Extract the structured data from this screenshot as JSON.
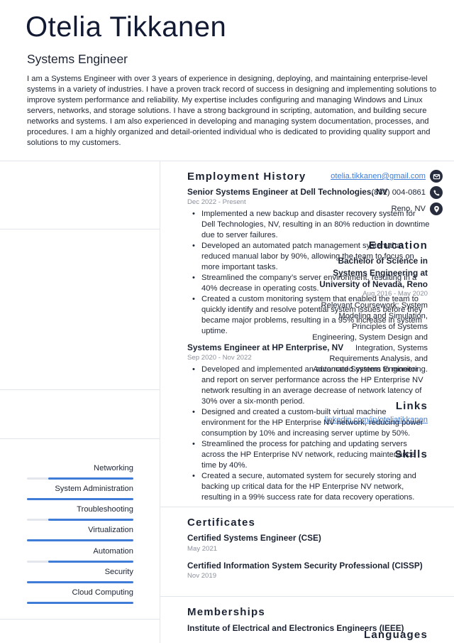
{
  "header": {
    "name": "Otelia Tikkanen",
    "title": "Systems Engineer",
    "summary": "I am a Systems Engineer with over 3 years of experience in designing, deploying, and maintaining enterprise-level systems in a variety of industries. I have a proven track record of success in designing and implementing solutions to improve system performance and reliability. My expertise includes configuring and managing Windows and Linux servers, networks, and storage solutions. I have a strong background in scripting, automation, and building secure networks and systems. I am also experienced in developing and managing system documentation, processes, and procedures. I am a highly organized and detail-oriented individual who is dedicated to providing quality support and solutions to my customers."
  },
  "contact": {
    "email": "otelia.tikkanen@gmail.com",
    "phone": "(831) 004-0861",
    "location": "Reno, NV",
    "icons": [
      "envelope-icon",
      "phone-icon",
      "map-pin-icon"
    ]
  },
  "education": {
    "heading": "Education",
    "degree": "Bachelor of Science in Systems Engineering at University of Nevada, Reno",
    "dates": "Aug 2016 - May 2020",
    "description": "Relevant Coursework: System Modeling and Simulation, Principles of Systems Engineering, System Design and Integration, Systems Requirements Analysis, and Advanced Systems Engineering."
  },
  "links": {
    "heading": "Links",
    "items": [
      "linkedin.com/in/oteliatikkanen"
    ]
  },
  "skills": {
    "heading": "Skills",
    "items": [
      {
        "name": "Networking",
        "level": 0.8
      },
      {
        "name": "System Administration",
        "level": 1.0
      },
      {
        "name": "Troubleshooting",
        "level": 0.8
      },
      {
        "name": "Virtualization",
        "level": 1.0
      },
      {
        "name": "Automation",
        "level": 0.8
      },
      {
        "name": "Security",
        "level": 1.0
      },
      {
        "name": "Cloud Computing",
        "level": 1.0
      }
    ]
  },
  "languages": {
    "heading": "Languages"
  },
  "employment": {
    "heading": "Employment History",
    "jobs": [
      {
        "title": "Senior Systems Engineer at Dell Technologies, NV",
        "dates": "Dec 2022 - Present",
        "bullets": [
          "Implemented a new backup and disaster recovery system for Dell Technologies, NV, resulting in an 80% reduction in downtime due to server failures.",
          "Developed an automated patch management system that reduced manual labor by 90%, allowing the team to focus on more important tasks.",
          "Streamlined the company’s server environment, resulting in a 40% decrease in operating costs.",
          "Created a custom monitoring system that enabled the team to quickly identify and resolve potential system issues before they became major problems, resulting in a 95% increase in system uptime."
        ]
      },
      {
        "title": "Systems Engineer at HP Enterprise, NV",
        "dates": "Sep 2020 - Nov 2022",
        "bullets": [
          "Developed and implemented an automated system to monitor and report on server performance across the HP Enterprise NV network resulting in an average decrease of network latency of 30% over a six-month period.",
          "Designed and created a custom-built virtual machine environment for the HP Enterprise NV network, reducing power consumption by 10% and increasing server uptime by 50%.",
          "Streamlined the process for patching and updating servers across the HP Enterprise NV network, reducing maintenance time by 40%.",
          "Created a secure, automated system for securely storing and backing up critical data for the HP Enterprise NV network, resulting in a 99% success rate for data recovery operations."
        ]
      }
    ]
  },
  "certificates": {
    "heading": "Certificates",
    "items": [
      {
        "name": "Certified Systems Engineer (CSE)",
        "date": "May 2021"
      },
      {
        "name": "Certified Information System Security Professional (CISSP)",
        "date": "Nov 2019"
      }
    ]
  },
  "memberships": {
    "heading": "Memberships",
    "items": [
      "Institute of Electrical and Electronics Engineers (IEEE)"
    ]
  },
  "colors": {
    "accent": "#3e7cd8",
    "text": "#1c2333",
    "muted": "#8b909c",
    "divider": "#e3e6ec",
    "icon_bg": "#282d3e"
  }
}
